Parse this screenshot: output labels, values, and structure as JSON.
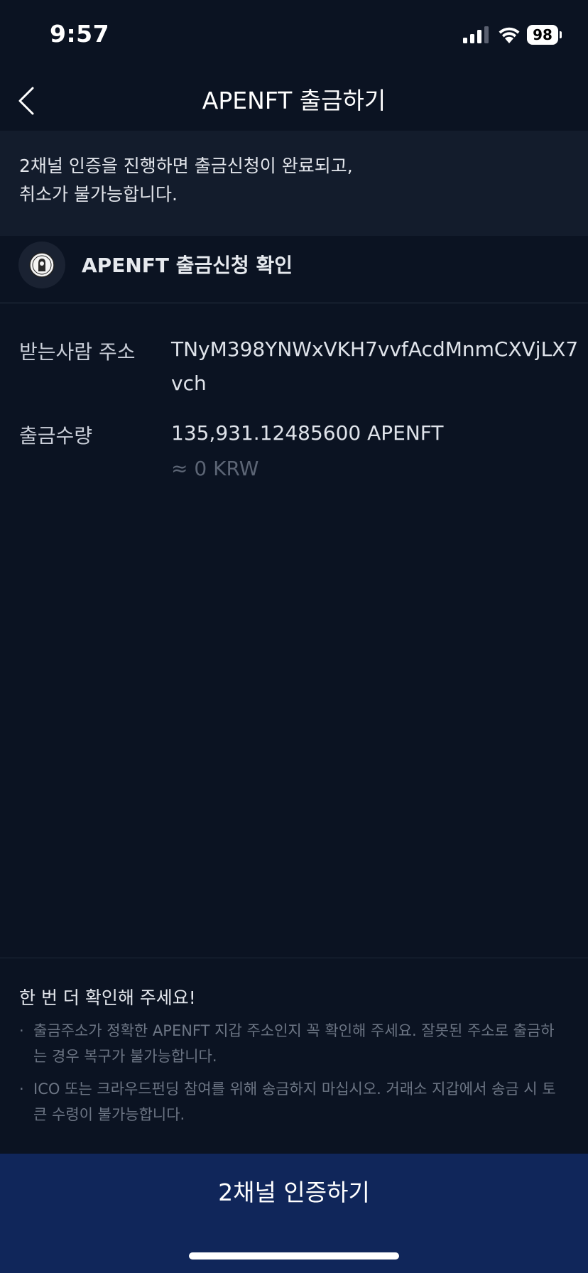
{
  "status_bar": {
    "time": "9:57",
    "battery": "98",
    "icons": [
      "signal-icon",
      "wifi-icon",
      "battery-icon"
    ]
  },
  "nav": {
    "back_icon": "chevron-left-icon",
    "title": "APENFT 출금하기"
  },
  "notice": {
    "text": "2채널 인증을 진행하면 출금신청이 완료되고,\n취소가 불가능합니다."
  },
  "confirm": {
    "logo_icon": "apenft-logo-icon",
    "title": "APENFT 출금신청 확인"
  },
  "details": {
    "recipient_label": "받는사람 주소",
    "recipient_value": "TNyM398YNWxVKH7vvfAcdMnmCXVjLX7vch",
    "amount_label": "출금수량",
    "amount_value": "135,931.12485600 APENFT",
    "amount_krw": "≈ 0 KRW"
  },
  "warning": {
    "title": "한 번 더 확인해 주세요!",
    "bullet": "·",
    "items": [
      "출금주소가 정확한 APENFT 지갑 주소인지 꼭 확인해 주세요. 잘못된 주소로 출금하는 경우 복구가 불가능합니다.",
      "ICO 또는 크라우드펀딩 참여를 위해 송금하지 마십시오. 거래소 지갑에서 송금 시 토큰 수령이 불가능합니다."
    ]
  },
  "action": {
    "label": "2채널 인증하기"
  },
  "colors": {
    "background": "#0b1322",
    "banner": "#131c2c",
    "button": "#10265a",
    "muted": "#6c7584"
  }
}
